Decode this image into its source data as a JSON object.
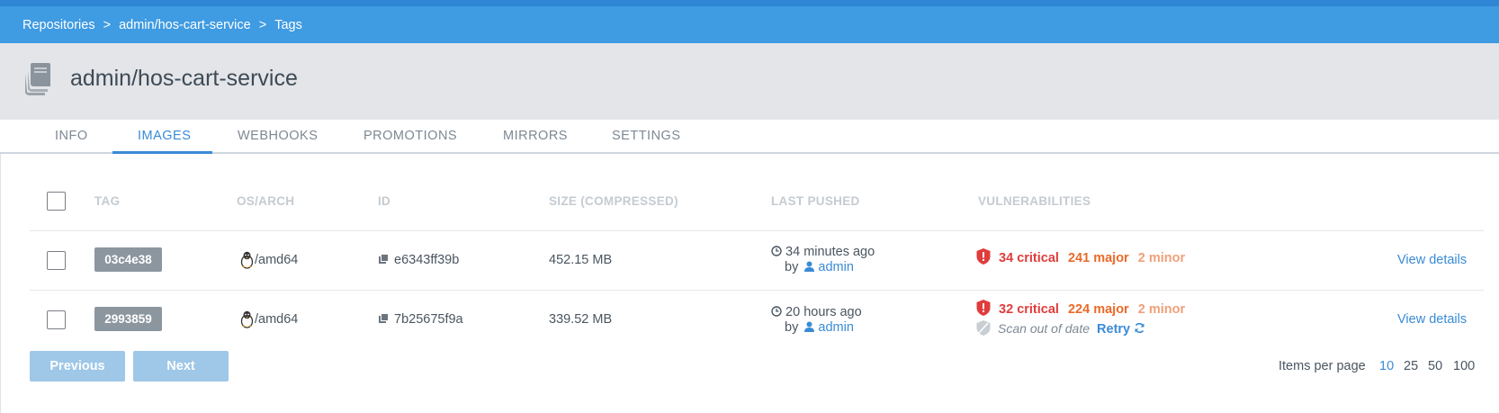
{
  "breadcrumb": {
    "items": [
      "Repositories",
      "admin/hos-cart-service",
      "Tags"
    ],
    "separator": ">"
  },
  "repo": {
    "title": "admin/hos-cart-service",
    "icon": "books-stack-icon"
  },
  "tabs": [
    {
      "label": "INFO"
    },
    {
      "label": "IMAGES",
      "active": true
    },
    {
      "label": "WEBHOOKS"
    },
    {
      "label": "PROMOTIONS"
    },
    {
      "label": "MIRRORS"
    },
    {
      "label": "SETTINGS"
    }
  ],
  "table": {
    "headers": [
      "TAG",
      "OS/ARCH",
      "ID",
      "SIZE (COMPRESSED)",
      "LAST PUSHED",
      "VULNERABILITIES"
    ],
    "rows": [
      {
        "tag": "03c4e38",
        "os_arch": "/amd64",
        "id": "e6343ff39b",
        "size": "452.15 MB",
        "pushed_time": "34 minutes ago",
        "by_label": "by",
        "pushed_by": "admin",
        "critical": "34 critical",
        "major": "241 major",
        "minor": "2 minor",
        "action": "View details"
      },
      {
        "tag": "2993859",
        "os_arch": "/amd64",
        "id": "7b25675f9a",
        "size": "339.52 MB",
        "pushed_time": "20 hours ago",
        "by_label": "by",
        "pushed_by": "admin",
        "critical": "32 critical",
        "major": "224 major",
        "minor": "2 minor",
        "scan_status": "Scan out of date",
        "retry": "Retry",
        "action": "View details"
      }
    ]
  },
  "pagination": {
    "previous": "Previous",
    "next": "Next",
    "items_per_page_label": "Items per page",
    "options": [
      "10",
      "25",
      "50",
      "100"
    ],
    "selected": "10"
  },
  "colors": {
    "accent": "#3a8bd6",
    "breadcrumb_bg": "#3f9be2",
    "critical": "#e03c3c",
    "major": "#ea6a2a",
    "minor": "#f0a07a"
  }
}
